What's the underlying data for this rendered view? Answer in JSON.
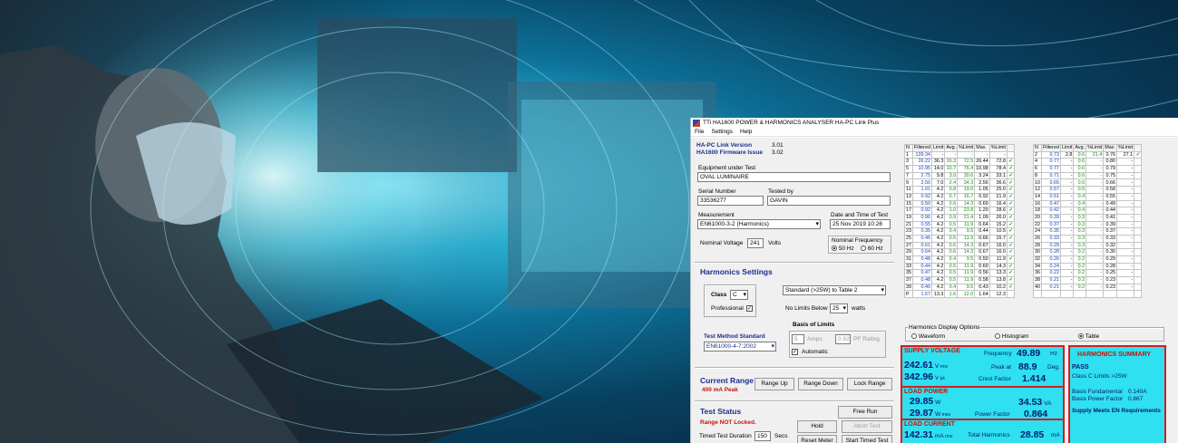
{
  "window": {
    "title": "TTi HA1600 POWER & HARMONICS ANALYSER HA-PC Link Plus",
    "menu": [
      "File",
      "Settings",
      "Help"
    ]
  },
  "versions": {
    "link_label": "HA-PC Link Version",
    "link_value": "3.01",
    "fw_label": "HA1600 Firmware Issue",
    "fw_value": "3.02"
  },
  "equipment": {
    "label": "Equipment under Test",
    "value": "OVAL LUMINAIRE",
    "serial_label": "Serial Number",
    "serial_value": "33536277",
    "tested_label": "Tested by",
    "tested_value": "GAVIN",
    "measurement_label": "Measurement",
    "measurement_value": "EN61000-3-2 (Harmonics)",
    "datetime_label": "Date and Time of Test",
    "datetime_value": "25 Nov 2019  10:26",
    "voltage_label": "Nominal Voltage",
    "voltage_value": "241",
    "voltage_unit": "Volts",
    "freq_label": "Nominal Frequency",
    "freq_50": "50 Hz",
    "freq_60": "60 Hz"
  },
  "harmonics_settings": {
    "title": "Harmonics Settings",
    "class_label": "Class",
    "class_value": "C",
    "professional_label": "Professional",
    "standard_value": "Standard (>25W) to Table 2",
    "no_limits_label": "No Limits Below",
    "no_limits_value": "25",
    "no_limits_unit": "watts",
    "basis_label": "Basis of Limits",
    "amps_value": "5",
    "amps_label": "Amps",
    "pf_value": "0.920",
    "pf_label": "PF Rating",
    "automatic_label": "Automatic",
    "method_label": "Test Method Standard",
    "method_value": "EN61000-4-7:2002"
  },
  "current_range": {
    "title": "Current Range",
    "value": "400 mA Peak",
    "up": "Range Up",
    "down": "Range Down",
    "lock": "Lock Range"
  },
  "test_status": {
    "title": "Test Status",
    "status": "Range NOT Locked.",
    "free_run": "Free Run",
    "hold": "Hold",
    "abort": "Abort Test",
    "duration_label": "Timed Test Duration",
    "duration_value": "150",
    "duration_unit": "Secs",
    "reset": "Reset Meter",
    "start": "Start Timed Test"
  },
  "table_headers": [
    "N",
    "Filtered",
    "Limit",
    "Avg.",
    "%Limit",
    "Max.",
    "%Limit"
  ],
  "table_left": [
    [
      "1",
      "139.34",
      "-",
      "-",
      "-",
      "-",
      "-",
      ""
    ],
    [
      "3",
      "26.22",
      "36.3",
      "26.3",
      "72.5",
      "26.44",
      "72.8",
      "ok"
    ],
    [
      "5",
      "10.95",
      "14.0",
      "10.7",
      "76.4",
      "10.98",
      "78.4",
      "ok"
    ],
    [
      "7",
      "2.75",
      "9.8",
      "3.0",
      "30.6",
      "3.24",
      "33.1",
      "ok"
    ],
    [
      "9",
      "2.50",
      "7.0",
      "2.4",
      "34.3",
      "2.56",
      "36.6",
      "ok"
    ],
    [
      "11",
      "1.01",
      "4.2",
      "0.8",
      "19.0",
      "1.05",
      "25.0",
      "ok"
    ],
    [
      "13",
      "0.92",
      "4.2",
      "0.7",
      "16.7",
      "0.92",
      "21.9",
      "ok"
    ],
    [
      "15",
      "0.50",
      "4.2",
      "0.6",
      "14.3",
      "0.69",
      "16.4",
      "ok"
    ],
    [
      "17",
      "0.92",
      "4.2",
      "1.0",
      "23.8",
      "1.20",
      "28.6",
      "ok"
    ],
    [
      "19",
      "0.96",
      "4.2",
      "0.9",
      "21.4",
      "1.09",
      "26.0",
      "ok"
    ],
    [
      "21",
      "0.55",
      "4.2",
      "0.5",
      "11.9",
      "0.64",
      "15.2",
      "ok"
    ],
    [
      "23",
      "0.35",
      "4.2",
      "0.4",
      "9.5",
      "0.44",
      "10.5",
      "ok"
    ],
    [
      "25",
      "0.46",
      "4.2",
      "0.5",
      "11.9",
      "0.66",
      "15.7",
      "ok"
    ],
    [
      "27",
      "0.61",
      "4.2",
      "0.6",
      "14.3",
      "0.67",
      "16.0",
      "ok"
    ],
    [
      "29",
      "0.64",
      "4.2",
      "0.6",
      "14.3",
      "0.67",
      "16.0",
      "ok"
    ],
    [
      "31",
      "0.48",
      "4.2",
      "0.4",
      "9.5",
      "0.50",
      "11.9",
      "ok"
    ],
    [
      "33",
      "0.44",
      "4.2",
      "0.5",
      "11.9",
      "0.60",
      "14.3",
      "ok"
    ],
    [
      "35",
      "0.47",
      "4.2",
      "0.5",
      "11.9",
      "0.56",
      "13.3",
      "ok"
    ],
    [
      "37",
      "0.48",
      "4.2",
      "0.5",
      "11.9",
      "0.58",
      "13.8",
      "ok"
    ],
    [
      "39",
      "0.40",
      "4.2",
      "0.4",
      "9.5",
      "0.43",
      "10.2",
      "ok"
    ],
    [
      "P",
      "1.57",
      "13.3",
      "1.6",
      "12.0",
      "1.64",
      "12.3",
      ""
    ]
  ],
  "table_right": [
    [
      "2",
      "0.73",
      "2.8",
      "0.6",
      "21.4",
      "0.76",
      "27.1",
      "ok"
    ],
    [
      "4",
      "0.77",
      "-",
      "0.6",
      "-",
      "0.80",
      "-",
      ""
    ],
    [
      "6",
      "0.77",
      "-",
      "0.6",
      "-",
      "0.79",
      "-",
      ""
    ],
    [
      "8",
      "0.71",
      "-",
      "0.6",
      "-",
      "0.75",
      "-",
      ""
    ],
    [
      "10",
      "0.65",
      "-",
      "0.5",
      "-",
      "0.66",
      "-",
      ""
    ],
    [
      "12",
      "0.57",
      "-",
      "0.5",
      "-",
      "0.58",
      "-",
      ""
    ],
    [
      "14",
      "0.51",
      "-",
      "0.4",
      "-",
      "0.55",
      "-",
      ""
    ],
    [
      "16",
      "0.47",
      "-",
      "0.4",
      "-",
      "0.49",
      "-",
      ""
    ],
    [
      "18",
      "0.42",
      "-",
      "0.4",
      "-",
      "0.44",
      "-",
      ""
    ],
    [
      "20",
      "0.39",
      "-",
      "0.3",
      "-",
      "0.41",
      "-",
      ""
    ],
    [
      "22",
      "0.37",
      "-",
      "0.3",
      "-",
      "0.39",
      "-",
      ""
    ],
    [
      "24",
      "0.35",
      "-",
      "0.3",
      "-",
      "0.37",
      "-",
      ""
    ],
    [
      "26",
      "0.33",
      "-",
      "0.3",
      "-",
      "0.33",
      "-",
      ""
    ],
    [
      "28",
      "0.29",
      "-",
      "0.3",
      "-",
      "0.32",
      "-",
      ""
    ],
    [
      "30",
      "0.28",
      "-",
      "0.2",
      "-",
      "0.30",
      "-",
      ""
    ],
    [
      "32",
      "0.26",
      "-",
      "0.2",
      "-",
      "0.29",
      "-",
      ""
    ],
    [
      "34",
      "0.24",
      "-",
      "0.2",
      "-",
      "0.28",
      "-",
      ""
    ],
    [
      "36",
      "0.22",
      "-",
      "0.2",
      "-",
      "0.25",
      "-",
      ""
    ],
    [
      "38",
      "0.21",
      "-",
      "0.2",
      "-",
      "0.23",
      "-",
      ""
    ],
    [
      "40",
      "0.21",
      "-",
      "0.2",
      "-",
      "0.23",
      "-",
      ""
    ],
    [
      "",
      "",
      "",
      "",
      "",
      "",
      "",
      ""
    ]
  ],
  "display_options": {
    "title": "Harmonics Display Options",
    "waveform": "Waveform",
    "histogram": "Histogram",
    "table": "Table"
  },
  "supply": {
    "title": "SUPPLY VOLTAGE",
    "vrms": "242.61",
    "vrms_unit": "V",
    "vpk": "342.96",
    "vpk_unit": "V",
    "freq_label": "Frequency",
    "freq_value": "49.89",
    "freq_unit": "Hz",
    "peak_label": "Peak at",
    "peak_value": "88.9",
    "peak_unit": "Deg.",
    "crest_label": "Crest Factor",
    "crest_value": "1.414"
  },
  "load_power": {
    "title": "LOAD POWER",
    "w": "29.85",
    "w_unit": "W",
    "wmax": "29.87",
    "wmax_unit": "W",
    "va": "34.53",
    "va_unit": "VA",
    "pf_label": "Power Factor",
    "pf_value": "0.864"
  },
  "load_current": {
    "title": "LOAD CURRENT",
    "rms": "142.31",
    "rms_unit": "mA",
    "th_label": "Total Harmonics",
    "th_value": "28.85",
    "th_unit": "mA"
  },
  "summary": {
    "title": "HARMONICS SUMMARY",
    "result": "PASS",
    "class_text": "Class C Limits >25W",
    "bf_label": "Basis Fundamental",
    "bf_value": "0.140A",
    "bpf_label": "Basis Power Factor",
    "bpf_value": "0.867",
    "meets": "Supply Meets EN Requirements"
  },
  "colors": {
    "accent": "#1c2f8c",
    "pass": "#10a010",
    "readout_bg": "#2ee0f0",
    "alert": "#c8140a"
  }
}
